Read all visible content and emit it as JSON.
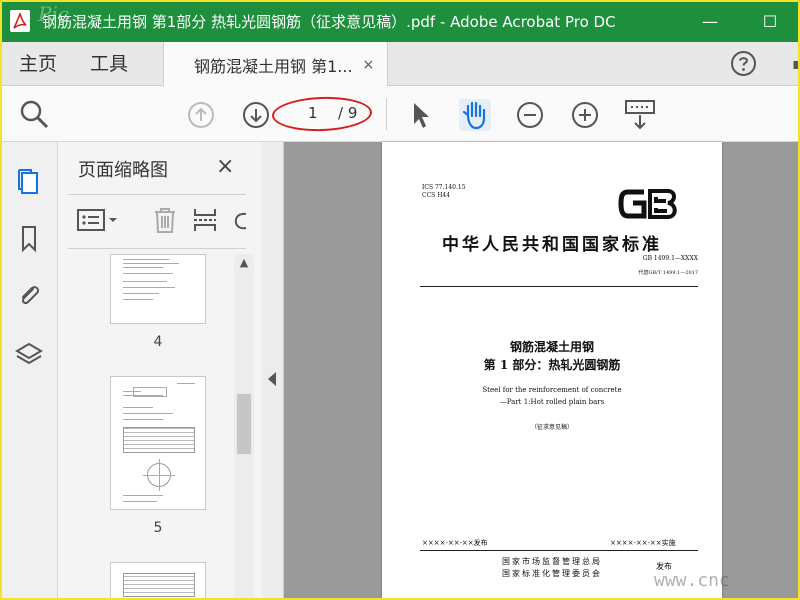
{
  "window": {
    "title": "钢筋混凝土用钢 第1部分 热轧光圆钢筋（征求意见稿）.pdf - Adobe Acrobat Pro DC",
    "minimize": "—",
    "maximize": "☐"
  },
  "tabs": {
    "home": "主页",
    "tools": "工具",
    "document": "钢筋混凝土用钢 第1...",
    "close": "×"
  },
  "toolbar": {
    "current_page": "1",
    "total_pages": "/ 9"
  },
  "thumbnails": {
    "title": "页面缩略图",
    "close": "×",
    "pages": [
      "4",
      "5"
    ]
  },
  "document": {
    "ics": "ICS 77.140.15",
    "ccs": "CCS H44",
    "logo": "GB",
    "national_standard": "中华人民共和国国家标准",
    "standard_number": "GB 1499.1—XXXX",
    "replaces": "代替GB/T 1499.1—2017",
    "title_line1": "钢筋混凝土用钢",
    "title_line2": "第 1 部分：热轧光圆钢筋",
    "english_line1": "Steel for the reinforcement of concrete",
    "english_line2": "—Part 1:Hot rolled plain bars",
    "draft": "（征求意见稿）",
    "published": "××××-××-××发布",
    "implemented": "××××-××-××实施",
    "issuer1": "国家市场监督管理总局",
    "issuer2": "国家标准化管理委员会",
    "issue": "发布"
  },
  "watermark": "www.cnc"
}
